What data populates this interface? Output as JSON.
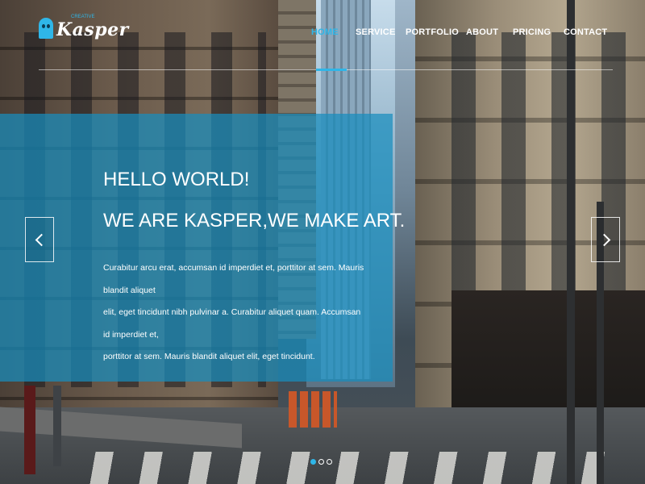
{
  "brand": {
    "name": "Kasper",
    "tagline": "CREATIVE"
  },
  "nav": {
    "items": [
      {
        "label": "HOME",
        "active": true
      },
      {
        "label": "SERVICE",
        "active": false
      },
      {
        "label": "PORTFOLIO",
        "active": false
      },
      {
        "label": "ABOUT",
        "active": false
      },
      {
        "label": "PRICING",
        "active": false
      },
      {
        "label": "CONTACT",
        "active": false
      }
    ]
  },
  "hero": {
    "title": "HELLO WORLD!",
    "subtitle": "WE ARE KASPER,WE MAKE ART.",
    "lines": [
      "Curabitur arcu erat, accumsan id imperdiet et, porttitor at sem. Mauris blandit aliquet",
      "elit, eget tincidunt nibh pulvinar a. Curabitur aliquet quam. Accumsan id imperdiet et,",
      "porttitor at sem. Mauris blandit aliquet elit, eget tincidunt."
    ]
  },
  "carousel": {
    "prev_icon": "chevron-left-icon",
    "next_icon": "chevron-right-icon",
    "slide_count": 3,
    "active_slide": 1
  },
  "colors": {
    "accent": "#2fb6e8",
    "overlay": "#178dbe",
    "text": "#ffffff"
  }
}
